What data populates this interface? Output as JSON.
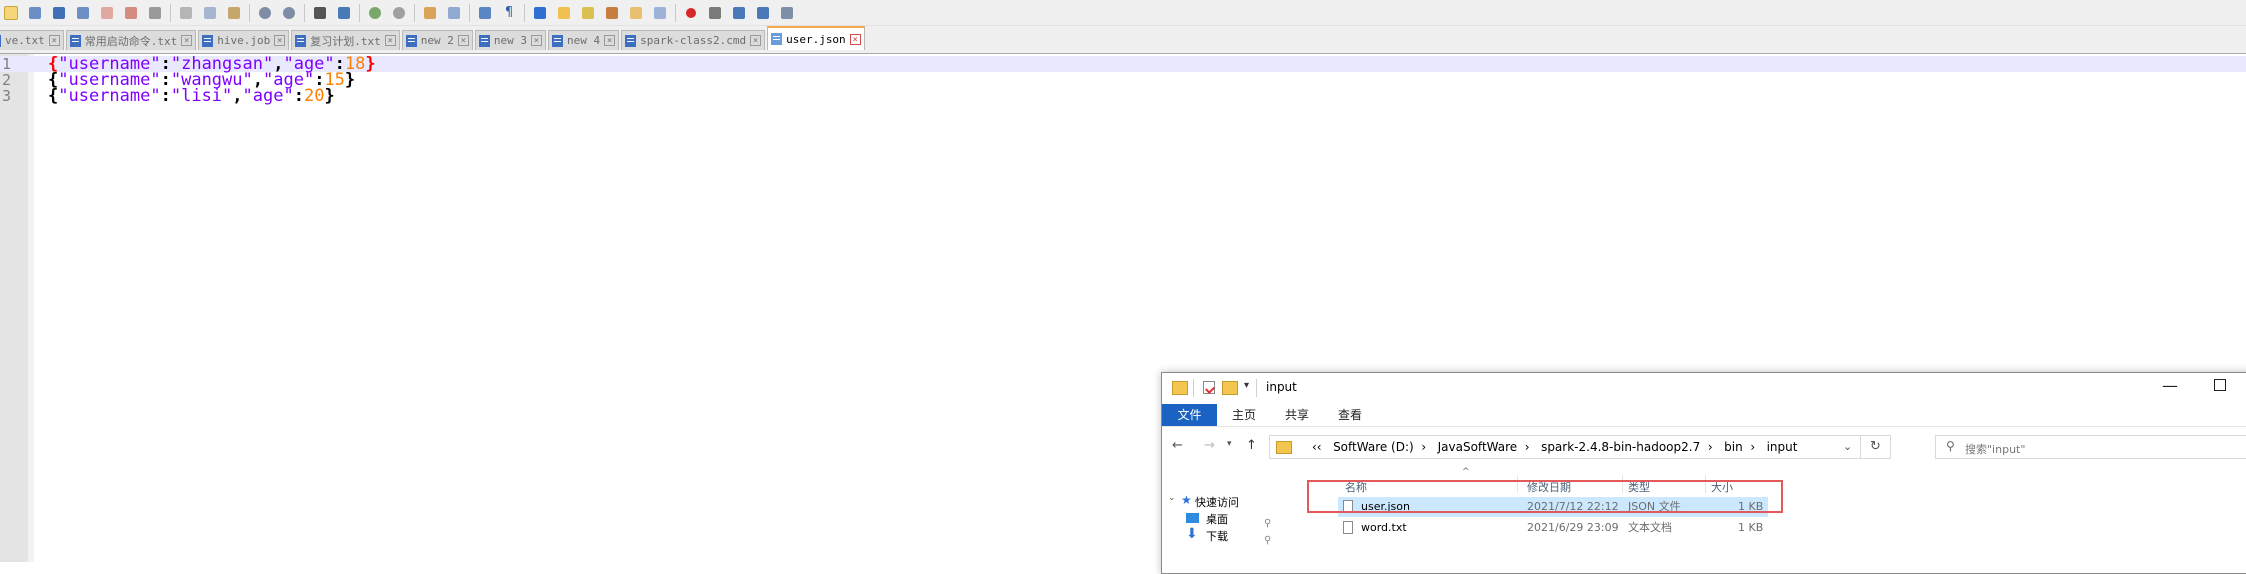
{
  "editor": {
    "tabs": [
      {
        "label": "ve.txt",
        "active": false
      },
      {
        "label": "常用启动命令.txt",
        "active": false
      },
      {
        "label": "hive.job",
        "active": false
      },
      {
        "label": "复习计划.txt",
        "active": false
      },
      {
        "label": "new 2",
        "active": false
      },
      {
        "label": "new 3",
        "active": false
      },
      {
        "label": "new 4",
        "active": false
      },
      {
        "label": "spark-class2.cmd",
        "active": false
      },
      {
        "label": "user.json",
        "active": true
      }
    ],
    "lines": [
      {
        "number": "1",
        "key1": "\"username\"",
        "val1": "\"zhangsan\"",
        "key2": "\"age\"",
        "num": "18"
      },
      {
        "number": "2",
        "key1": "\"username\"",
        "val1": "\"wangwu\"",
        "key2": "\"age\"",
        "num": "15"
      },
      {
        "number": "3",
        "key1": "\"username\"",
        "val1": "\"lisi\"",
        "key2": "\"age\"",
        "num": "20"
      }
    ],
    "colors": {
      "bracket_highlight": "#ff0000",
      "string": "#8000ff",
      "number": "#ff8000",
      "current_line": "#e8e8ff"
    }
  },
  "explorer": {
    "title": "input",
    "ribbon_tabs": [
      "文件",
      "主页",
      "共享",
      "查看"
    ],
    "breadcrumb": {
      "overflow": "‹‹",
      "items": [
        "SoftWare (D:)",
        "JavaSoftWare",
        "spark-2.4.8-bin-hadoop2.7",
        "bin",
        "input"
      ],
      "separator": "›"
    },
    "search_placeholder": "搜索\"input\"",
    "columns": {
      "name": "名称",
      "date": "修改日期",
      "type": "类型",
      "size": "大小"
    },
    "sidebar": {
      "quick_access": "快速访问",
      "desktop": "桌面",
      "downloads": "下载"
    },
    "files": [
      {
        "name": "user.json",
        "date": "2021/7/12 22:12",
        "type": "JSON 文件",
        "size": "1 KB",
        "selected": true
      },
      {
        "name": "word.txt",
        "date": "2021/6/29 23:09",
        "type": "文本文档",
        "size": "1 KB",
        "selected": false
      }
    ],
    "colors": {
      "file_tab": "#1a63c2",
      "selection": "#cce8ff",
      "highlight_box": "#e35a5a"
    }
  }
}
